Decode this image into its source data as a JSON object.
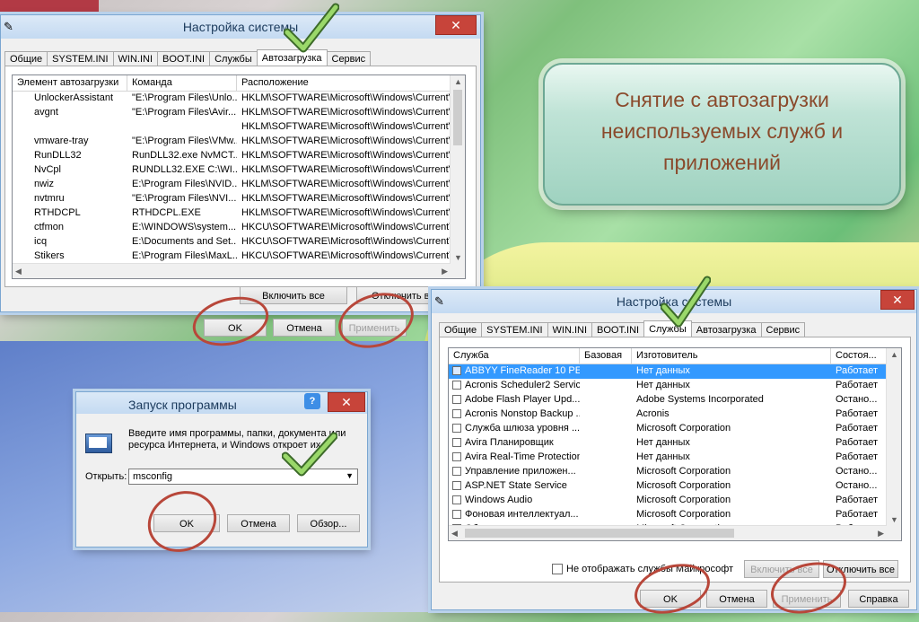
{
  "win1": {
    "title": "Настройка системы",
    "tabs": [
      "Общие",
      "SYSTEM.INI",
      "WIN.INI",
      "BOOT.INI",
      "Службы",
      "Автозагрузка",
      "Сервис"
    ],
    "active_tab": 5,
    "columns": [
      "Элемент автозагрузки",
      "Команда",
      "Расположение"
    ],
    "rows": [
      [
        "UnlockerAssistant",
        "\"E:\\Program Files\\Unlo...",
        "HKLM\\SOFTWARE\\Microsoft\\Windows\\CurrentVer..."
      ],
      [
        "avgnt",
        "\"E:\\Program Files\\Avir...",
        "HKLM\\SOFTWARE\\Microsoft\\Windows\\CurrentVer..."
      ],
      [
        "",
        "",
        "HKLM\\SOFTWARE\\Microsoft\\Windows\\CurrentVer..."
      ],
      [
        "vmware-tray",
        "\"E:\\Program Files\\VMw...",
        "HKLM\\SOFTWARE\\Microsoft\\Windows\\CurrentVer..."
      ],
      [
        "RunDLL32",
        "RunDLL32.exe NvMCT...",
        "HKLM\\SOFTWARE\\Microsoft\\Windows\\CurrentVer..."
      ],
      [
        "NvCpl",
        "RUNDLL32.EXE C:\\WI...",
        "HKLM\\SOFTWARE\\Microsoft\\Windows\\CurrentVer..."
      ],
      [
        "nwiz",
        "E:\\Program Files\\NVID...",
        "HKLM\\SOFTWARE\\Microsoft\\Windows\\CurrentVer..."
      ],
      [
        "nvtmru",
        "\"E:\\Program Files\\NVI...",
        "HKLM\\SOFTWARE\\Microsoft\\Windows\\CurrentVer..."
      ],
      [
        "RTHDCPL",
        "RTHDCPL.EXE",
        "HKLM\\SOFTWARE\\Microsoft\\Windows\\CurrentVer..."
      ],
      [
        "ctfmon",
        "E:\\WINDOWS\\system...",
        "HKCU\\SOFTWARE\\Microsoft\\Windows\\CurrentVer..."
      ],
      [
        "icq",
        "E:\\Documents and Set...",
        "HKCU\\SOFTWARE\\Microsoft\\Windows\\CurrentVer..."
      ],
      [
        "Stikers",
        "E:\\Program Files\\MaxL...",
        "HKCU\\SOFTWARE\\Microsoft\\Windows\\CurrentVer..."
      ]
    ],
    "enable_all": "Включить все",
    "disable_all": "Отключить все",
    "ok": "OK",
    "cancel": "Отмена",
    "apply": "Применить"
  },
  "glass_text": "Снятие с автозагрузки неиспользуемых служб и приложений",
  "run": {
    "title": "Запуск программы",
    "help": "?",
    "description": "Введите имя программы, папки, документа или ресурса Интернета, и Windows откроет их.",
    "open_label": "Открыть:",
    "open_value": "msconfig",
    "ok": "OK",
    "cancel": "Отмена",
    "browse": "Обзор..."
  },
  "win2": {
    "title": "Настройка системы",
    "tabs": [
      "Общие",
      "SYSTEM.INI",
      "WIN.INI",
      "BOOT.INI",
      "Службы",
      "Автозагрузка",
      "Сервис"
    ],
    "active_tab": 4,
    "columns": [
      "Служба",
      "Базовая",
      "Изготовитель",
      "Состоя..."
    ],
    "rows": [
      [
        "ABBYY FineReader 10 PE...",
        "",
        "Нет данных",
        "Работает"
      ],
      [
        "Acronis Scheduler2 Service",
        "",
        "Нет данных",
        "Работает"
      ],
      [
        "Adobe Flash Player Upd...",
        "",
        "Adobe Systems Incorporated",
        "Остано..."
      ],
      [
        "Acronis Nonstop Backup ...",
        "",
        "Acronis",
        "Работает"
      ],
      [
        "Служба шлюза уровня ...",
        "",
        "Microsoft Corporation",
        "Работает"
      ],
      [
        "Avira Планировщик",
        "",
        "Нет данных",
        "Работает"
      ],
      [
        "Avira Real-Time Protection",
        "",
        "Нет данных",
        "Работает"
      ],
      [
        "Управление приложен...",
        "",
        "Microsoft Corporation",
        "Остано..."
      ],
      [
        "ASP.NET State Service",
        "",
        "Microsoft Corporation",
        "Остано..."
      ],
      [
        "Windows Audio",
        "",
        "Microsoft Corporation",
        "Работает"
      ],
      [
        "Фоновая интеллектуал...",
        "",
        "Microsoft Corporation",
        "Работает"
      ],
      [
        "Обозреватель компью...",
        "",
        "Microsoft Corporation",
        "Работает"
      ]
    ],
    "hide_ms_label": "Не отображать службы Майкрософт",
    "enable_all": "Включить все",
    "disable_all": "Отключить все",
    "ok": "OK",
    "cancel": "Отмена",
    "apply": "Применить",
    "help": "Справка"
  },
  "colors": {
    "accent": "#3399ff",
    "ring": "#b8473a",
    "check": "#7cc24a",
    "glass_text": "#8a4a2c"
  }
}
